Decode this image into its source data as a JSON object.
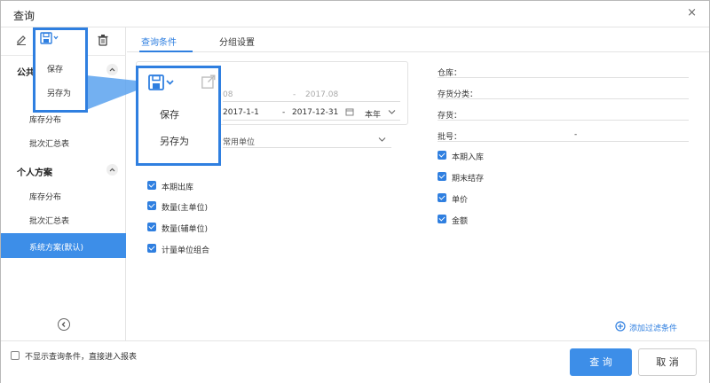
{
  "dialog": {
    "title": "查询",
    "close_glyph": "×"
  },
  "toolbar": {
    "edit": "edit-icon",
    "save": "save-icon",
    "export": "export-icon",
    "delete": "delete-icon"
  },
  "sidebar": {
    "public_title": "公共方案",
    "public_items": [
      "库存分布",
      "批次汇总表"
    ],
    "personal_title": "个人方案",
    "personal_items": [
      "库存分布",
      "批次汇总表",
      "系统方案(默认)"
    ],
    "collapse_glyph": "‹"
  },
  "tabs": [
    {
      "label": "查询条件"
    },
    {
      "label": "分组设置"
    }
  ],
  "date_section": {
    "row1_start_tail": "08",
    "row1_dash": "-",
    "row1_end": "2017.08",
    "row2_start": "2017-1-1",
    "row2_dash": "-",
    "row2_end": "2017-12-31",
    "period": "本年",
    "unit": "常用单位"
  },
  "left_checks": [
    "本期出库",
    "数量(主单位)",
    "数量(辅单位)",
    "计量单位组合"
  ],
  "right_fields": {
    "warehouse": "仓库：",
    "category": "存货分类：",
    "inventory": "存货：",
    "batch": "批号：",
    "batch_dash": "-"
  },
  "right_checks": [
    "本期入库",
    "期末结存",
    "单价",
    "金额"
  ],
  "add_filter": "添加过滤条件",
  "footer": {
    "skip_label": "不显示查询条件，直接进入报表",
    "query": "查 询",
    "cancel": "取 消"
  },
  "menu": {
    "save": "保存",
    "save_as": "另存为"
  },
  "colors": {
    "accent": "#2f7fe0",
    "active_item": "#3d8ee8"
  }
}
